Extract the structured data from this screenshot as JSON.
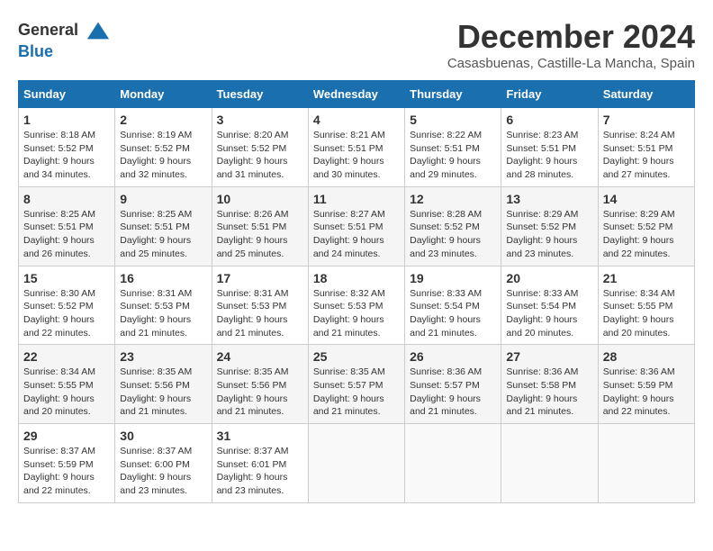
{
  "header": {
    "logo_line1": "General",
    "logo_line2": "Blue",
    "month_title": "December 2024",
    "location": "Casasbuenas, Castille-La Mancha, Spain"
  },
  "weekdays": [
    "Sunday",
    "Monday",
    "Tuesday",
    "Wednesday",
    "Thursday",
    "Friday",
    "Saturday"
  ],
  "weeks": [
    [
      {
        "day": "1",
        "sunrise": "8:18 AM",
        "sunset": "5:52 PM",
        "daylight_hours": "9",
        "daylight_minutes": "34"
      },
      {
        "day": "2",
        "sunrise": "8:19 AM",
        "sunset": "5:52 PM",
        "daylight_hours": "9",
        "daylight_minutes": "32"
      },
      {
        "day": "3",
        "sunrise": "8:20 AM",
        "sunset": "5:52 PM",
        "daylight_hours": "9",
        "daylight_minutes": "31"
      },
      {
        "day": "4",
        "sunrise": "8:21 AM",
        "sunset": "5:51 PM",
        "daylight_hours": "9",
        "daylight_minutes": "30"
      },
      {
        "day": "5",
        "sunrise": "8:22 AM",
        "sunset": "5:51 PM",
        "daylight_hours": "9",
        "daylight_minutes": "29"
      },
      {
        "day": "6",
        "sunrise": "8:23 AM",
        "sunset": "5:51 PM",
        "daylight_hours": "9",
        "daylight_minutes": "28"
      },
      {
        "day": "7",
        "sunrise": "8:24 AM",
        "sunset": "5:51 PM",
        "daylight_hours": "9",
        "daylight_minutes": "27"
      }
    ],
    [
      {
        "day": "8",
        "sunrise": "8:25 AM",
        "sunset": "5:51 PM",
        "daylight_hours": "9",
        "daylight_minutes": "26"
      },
      {
        "day": "9",
        "sunrise": "8:25 AM",
        "sunset": "5:51 PM",
        "daylight_hours": "9",
        "daylight_minutes": "25"
      },
      {
        "day": "10",
        "sunrise": "8:26 AM",
        "sunset": "5:51 PM",
        "daylight_hours": "9",
        "daylight_minutes": "25"
      },
      {
        "day": "11",
        "sunrise": "8:27 AM",
        "sunset": "5:51 PM",
        "daylight_hours": "9",
        "daylight_minutes": "24"
      },
      {
        "day": "12",
        "sunrise": "8:28 AM",
        "sunset": "5:52 PM",
        "daylight_hours": "9",
        "daylight_minutes": "23"
      },
      {
        "day": "13",
        "sunrise": "8:29 AM",
        "sunset": "5:52 PM",
        "daylight_hours": "9",
        "daylight_minutes": "23"
      },
      {
        "day": "14",
        "sunrise": "8:29 AM",
        "sunset": "5:52 PM",
        "daylight_hours": "9",
        "daylight_minutes": "22"
      }
    ],
    [
      {
        "day": "15",
        "sunrise": "8:30 AM",
        "sunset": "5:52 PM",
        "daylight_hours": "9",
        "daylight_minutes": "22"
      },
      {
        "day": "16",
        "sunrise": "8:31 AM",
        "sunset": "5:53 PM",
        "daylight_hours": "9",
        "daylight_minutes": "21"
      },
      {
        "day": "17",
        "sunrise": "8:31 AM",
        "sunset": "5:53 PM",
        "daylight_hours": "9",
        "daylight_minutes": "21"
      },
      {
        "day": "18",
        "sunrise": "8:32 AM",
        "sunset": "5:53 PM",
        "daylight_hours": "9",
        "daylight_minutes": "21"
      },
      {
        "day": "19",
        "sunrise": "8:33 AM",
        "sunset": "5:54 PM",
        "daylight_hours": "9",
        "daylight_minutes": "21"
      },
      {
        "day": "20",
        "sunrise": "8:33 AM",
        "sunset": "5:54 PM",
        "daylight_hours": "9",
        "daylight_minutes": "20"
      },
      {
        "day": "21",
        "sunrise": "8:34 AM",
        "sunset": "5:55 PM",
        "daylight_hours": "9",
        "daylight_minutes": "20"
      }
    ],
    [
      {
        "day": "22",
        "sunrise": "8:34 AM",
        "sunset": "5:55 PM",
        "daylight_hours": "9",
        "daylight_minutes": "20"
      },
      {
        "day": "23",
        "sunrise": "8:35 AM",
        "sunset": "5:56 PM",
        "daylight_hours": "9",
        "daylight_minutes": "21"
      },
      {
        "day": "24",
        "sunrise": "8:35 AM",
        "sunset": "5:56 PM",
        "daylight_hours": "9",
        "daylight_minutes": "21"
      },
      {
        "day": "25",
        "sunrise": "8:35 AM",
        "sunset": "5:57 PM",
        "daylight_hours": "9",
        "daylight_minutes": "21"
      },
      {
        "day": "26",
        "sunrise": "8:36 AM",
        "sunset": "5:57 PM",
        "daylight_hours": "9",
        "daylight_minutes": "21"
      },
      {
        "day": "27",
        "sunrise": "8:36 AM",
        "sunset": "5:58 PM",
        "daylight_hours": "9",
        "daylight_minutes": "21"
      },
      {
        "day": "28",
        "sunrise": "8:36 AM",
        "sunset": "5:59 PM",
        "daylight_hours": "9",
        "daylight_minutes": "22"
      }
    ],
    [
      {
        "day": "29",
        "sunrise": "8:37 AM",
        "sunset": "5:59 PM",
        "daylight_hours": "9",
        "daylight_minutes": "22"
      },
      {
        "day": "30",
        "sunrise": "8:37 AM",
        "sunset": "6:00 PM",
        "daylight_hours": "9",
        "daylight_minutes": "23"
      },
      {
        "day": "31",
        "sunrise": "8:37 AM",
        "sunset": "6:01 PM",
        "daylight_hours": "9",
        "daylight_minutes": "23"
      },
      null,
      null,
      null,
      null
    ]
  ]
}
